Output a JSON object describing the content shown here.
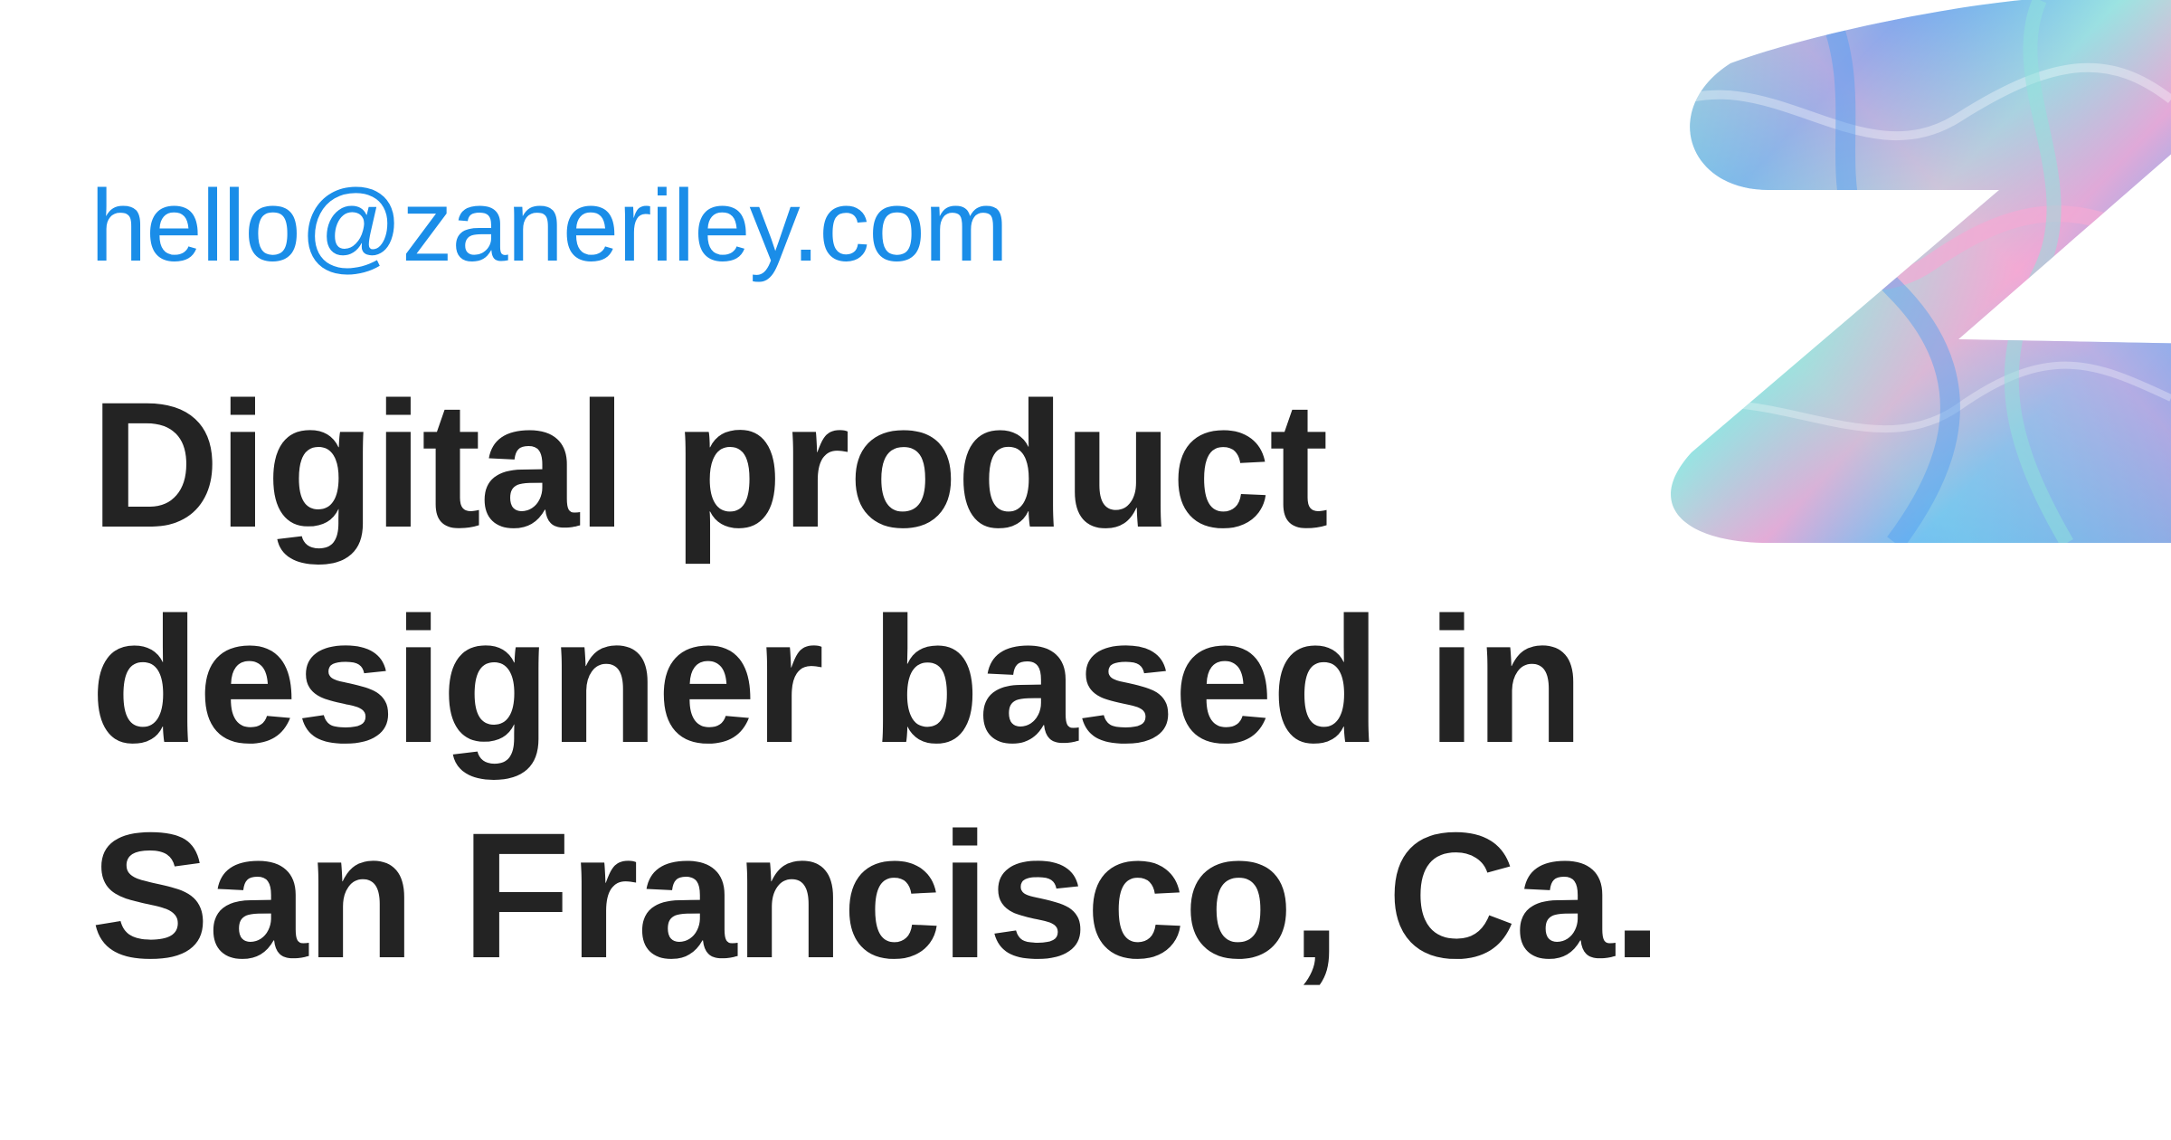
{
  "contact": {
    "email": "hello@zaneriley.com"
  },
  "headline": {
    "lines": [
      "Digital product",
      "designer based in",
      "San Francisco, Ca."
    ]
  },
  "logo": {
    "icon": "swirl-z-logo-icon"
  },
  "colors": {
    "background": "#ffffff",
    "email": "#1a8de8",
    "headline": "#232323",
    "swirl_blue": "#5aa9f5",
    "swirl_teal": "#8fe3dc",
    "swirl_pink": "#f4a9d4"
  }
}
